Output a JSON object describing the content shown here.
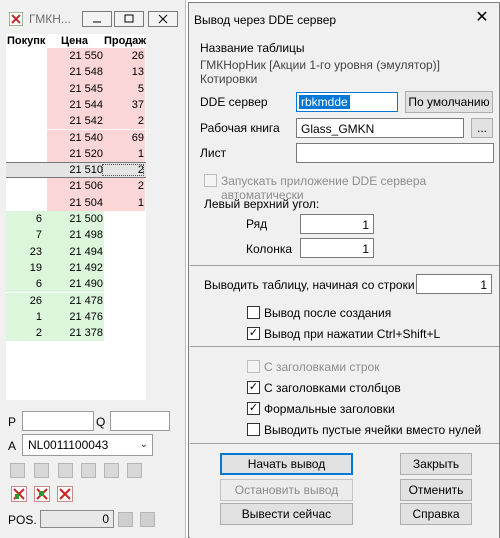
{
  "glass": {
    "title": "ГМКН...",
    "columns": {
      "buy": "Покупк",
      "price": "Цена",
      "sell": "Продаж"
    },
    "rows": [
      {
        "buy": "",
        "price": "21 550",
        "sell": "26",
        "side": "sell"
      },
      {
        "buy": "",
        "price": "21 548",
        "sell": "13",
        "side": "sell"
      },
      {
        "buy": "",
        "price": "21 545",
        "sell": "5",
        "side": "sell"
      },
      {
        "buy": "",
        "price": "21 544",
        "sell": "37",
        "side": "sell"
      },
      {
        "buy": "",
        "price": "21 542",
        "sell": "2",
        "side": "sell"
      },
      {
        "buy": "",
        "price": "21 540",
        "sell": "69",
        "side": "sell"
      },
      {
        "buy": "",
        "price": "21 520",
        "sell": "1",
        "side": "sell"
      },
      {
        "buy": "",
        "price": "21 510",
        "sell": "2",
        "side": "selected"
      },
      {
        "buy": "",
        "price": "21 506",
        "sell": "2",
        "side": "sell"
      },
      {
        "buy": "",
        "price": "21 504",
        "sell": "1",
        "side": "sell"
      },
      {
        "buy": "6",
        "price": "21 500",
        "sell": "",
        "side": "buy"
      },
      {
        "buy": "7",
        "price": "21 498",
        "sell": "",
        "side": "buy"
      },
      {
        "buy": "23",
        "price": "21 494",
        "sell": "",
        "side": "buy"
      },
      {
        "buy": "19",
        "price": "21 492",
        "sell": "",
        "side": "buy"
      },
      {
        "buy": "6",
        "price": "21 490",
        "sell": "",
        "side": "buy"
      },
      {
        "buy": "26",
        "price": "21 478",
        "sell": "",
        "side": "buy"
      },
      {
        "buy": "1",
        "price": "21 476",
        "sell": "",
        "side": "buy"
      },
      {
        "buy": "2",
        "price": "21 378",
        "sell": "",
        "side": "buy"
      }
    ],
    "p_label": "P",
    "q_label": "Q",
    "a_label": "A",
    "account": "NL0011100043",
    "pos_label": "POS.",
    "pos_value": "0"
  },
  "dialog": {
    "title": "Вывод через DDE сервер",
    "close": "✕",
    "table_name_label": "Название таблицы",
    "table_name_value": "ГМКНорНик [Акции 1-го уровня (эмулятор)] Котировки",
    "dde_server_label": "DDE сервер",
    "dde_server_value": "rbkmdde",
    "default_button": "По умолчанию",
    "workbook_label": "Рабочая книга",
    "workbook_value": "Glass_GMKN",
    "browse_button": "...",
    "sheet_label": "Лист",
    "sheet_value": "",
    "autostart_label": "Запускать приложение DDE сервера автоматически",
    "top_left_label": "Левый верхний угол:",
    "row_label": "Ряд",
    "row_value": "1",
    "col_label": "Колонка",
    "col_value": "1",
    "start_row_label": "Выводить таблицу,  начиная со строки",
    "start_row_value": "1",
    "opt_after_create": "Вывод после создания",
    "opt_hotkey": "Вывод при нажатии Ctrl+Shift+L",
    "opt_row_headers": "С заголовками строк",
    "opt_col_headers": "С заголовками столбцов",
    "opt_formal_headers": "Формальные заголовки",
    "opt_empty_cells": "Выводить пустые ячейки вместо нулей",
    "btn_start": "Начать вывод",
    "btn_stop": "Остановить вывод",
    "btn_now": "Вывести сейчас",
    "btn_close": "Закрыть",
    "btn_cancel": "Отменить",
    "btn_help": "Справка"
  },
  "colors": {
    "sell_bg": "#fbd6d6",
    "buy_bg": "#dcf6dc",
    "focus": "#0078d7"
  }
}
